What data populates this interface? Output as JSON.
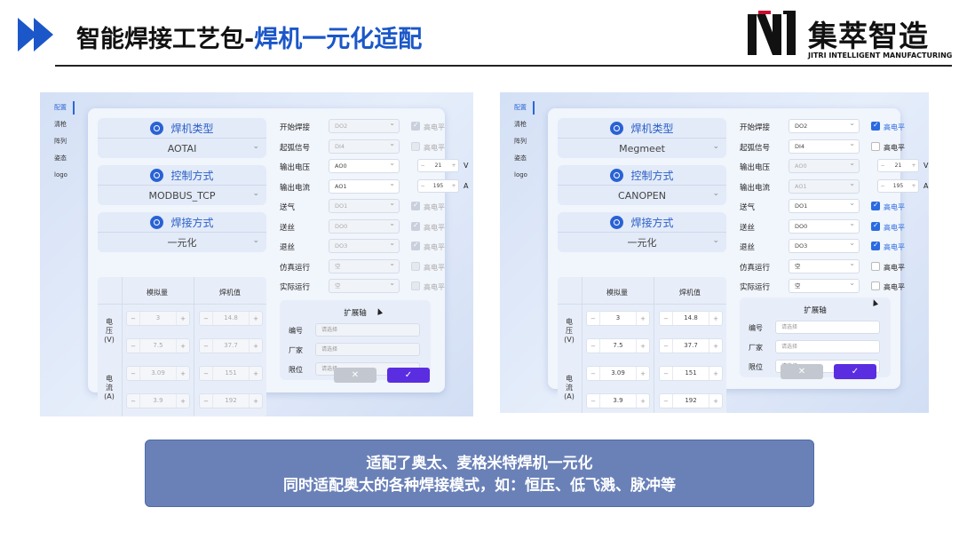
{
  "header": {
    "title_main": "智能焊接工艺包-",
    "title_sub": "焊机一元化适配",
    "logo_cn": "集萃智造",
    "logo_en": "JITRI INTELLIGENT MANUFACTURING"
  },
  "colors": {
    "accent": "#1b57c8",
    "confirm": "#5b2de0",
    "caption_bg": "#6a81b8"
  },
  "sidebar": [
    "配置",
    "清枪",
    "阵列",
    "姿态",
    "logo"
  ],
  "panels": [
    {
      "welder_type_label": "焊机类型",
      "welder_type": "AOTAI",
      "control_label": "控制方式",
      "control": "MODBUS_TCP",
      "mode_label": "焊接方式",
      "mode": "一元化",
      "table": {
        "col1": "模拟量",
        "col2": "焊机值",
        "voltage_label": "电压(V)",
        "current_label": "电流(A)",
        "rows": [
          [
            "3",
            "14.8"
          ],
          [
            "7.5",
            "37.7"
          ],
          [
            "3.09",
            "151"
          ],
          [
            "3.9",
            "192"
          ]
        ]
      },
      "fields": [
        {
          "label": "开始焊接",
          "value": "DO2",
          "check": "高电平",
          "on": true,
          "disabled": true
        },
        {
          "label": "起弧信号",
          "value": "DI4",
          "check": "高电平",
          "on": false,
          "disabled": true
        },
        {
          "label": "输出电压",
          "value": "AO0",
          "num": "21",
          "unit": "V",
          "disabled": false
        },
        {
          "label": "输出电流",
          "value": "AO1",
          "num": "195",
          "unit": "A",
          "disabled": false
        },
        {
          "label": "送气",
          "value": "DO1",
          "check": "高电平",
          "on": true,
          "disabled": true
        },
        {
          "label": "送丝",
          "value": "DO0",
          "check": "高电平",
          "on": true,
          "disabled": true
        },
        {
          "label": "退丝",
          "value": "DO3",
          "check": "高电平",
          "on": true,
          "disabled": true
        },
        {
          "label": "仿真运行",
          "value": "空",
          "check": "高电平",
          "on": false,
          "disabled": true
        },
        {
          "label": "实际运行",
          "value": "空",
          "check": "高电平",
          "on": false,
          "disabled": true
        }
      ],
      "ext": {
        "title": "扩展轴",
        "rows": [
          {
            "l": "编号",
            "p": "请选择"
          },
          {
            "l": "厂家",
            "p": "请选择"
          },
          {
            "l": "限位",
            "p": "请选择"
          }
        ]
      },
      "cancel": "✕",
      "ok": "✓"
    },
    {
      "welder_type_label": "焊机类型",
      "welder_type": "Megmeet",
      "control_label": "控制方式",
      "control": "CANOPEN",
      "mode_label": "焊接方式",
      "mode": "一元化",
      "table": {
        "col1": "模拟量",
        "col2": "焊机值",
        "voltage_label": "电压(V)",
        "current_label": "电流(A)",
        "rows": [
          [
            "3",
            "14.8"
          ],
          [
            "7.5",
            "37.7"
          ],
          [
            "3.09",
            "151"
          ],
          [
            "3.9",
            "192"
          ]
        ]
      },
      "fields": [
        {
          "label": "开始焊接",
          "value": "DO2",
          "check": "高电平",
          "on": true,
          "disabled": false
        },
        {
          "label": "起弧信号",
          "value": "DI4",
          "check": "高电平",
          "on": false,
          "disabled": false
        },
        {
          "label": "输出电压",
          "value": "AO0",
          "num": "21",
          "unit": "V",
          "disabled": true
        },
        {
          "label": "输出电流",
          "value": "AO1",
          "num": "195",
          "unit": "A",
          "disabled": true
        },
        {
          "label": "送气",
          "value": "DO1",
          "check": "高电平",
          "on": true,
          "disabled": false
        },
        {
          "label": "送丝",
          "value": "DO0",
          "check": "高电平",
          "on": true,
          "disabled": false
        },
        {
          "label": "退丝",
          "value": "DO3",
          "check": "高电平",
          "on": true,
          "disabled": false
        },
        {
          "label": "仿真运行",
          "value": "空",
          "check": "高电平",
          "on": false,
          "disabled": false
        },
        {
          "label": "实际运行",
          "value": "空",
          "check": "高电平",
          "on": false,
          "disabled": false
        }
      ],
      "ext": {
        "title": "扩展轴",
        "rows": [
          {
            "l": "编号",
            "p": "请选择"
          },
          {
            "l": "厂家",
            "p": "请选择"
          },
          {
            "l": "限位",
            "p": "请选择"
          }
        ]
      },
      "cancel": "✕",
      "ok": "✓"
    }
  ],
  "caption": {
    "line1": "适配了奥太、麦格米特焊机一元化",
    "line2": "同时适配奥太的各种焊接模式，如：恒压、低飞溅、脉冲等"
  }
}
